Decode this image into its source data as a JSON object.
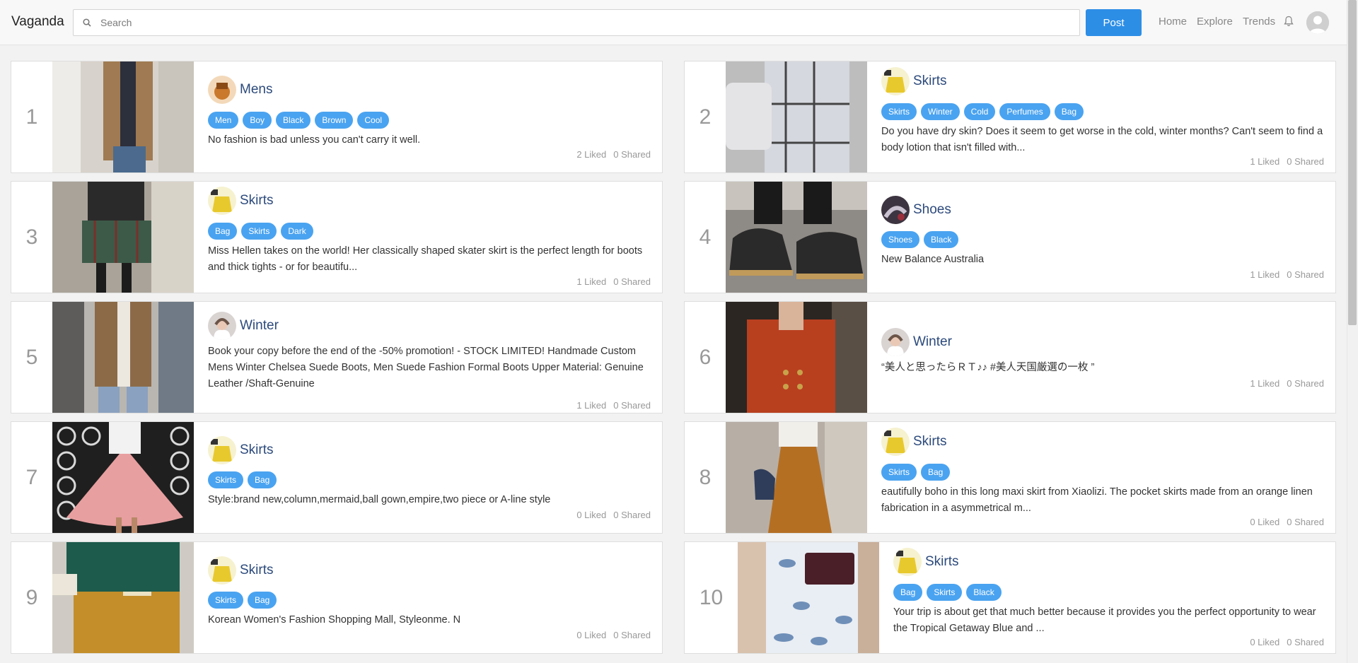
{
  "brand": "Vaganda",
  "search": {
    "placeholder": "Search"
  },
  "post_label": "Post",
  "nav": {
    "home": "Home",
    "explore": "Explore",
    "trends": "Trends"
  },
  "colors": {
    "accent": "#2d8ee6",
    "tag": "#4aa3f0",
    "title": "#2c4a7c"
  },
  "cards": [
    {
      "rank": "1",
      "title": "Mens",
      "tags": [
        "Men",
        "Boy",
        "Black",
        "Brown",
        "Cool"
      ],
      "desc": "No fashion is bad unless you can't carry it well.",
      "liked": "2 Liked",
      "shared": "0 Shared"
    },
    {
      "rank": "2",
      "title": "Skirts",
      "tags": [
        "Skirts",
        "Winter",
        "Cold",
        "Perfumes",
        "Bag"
      ],
      "desc": "Do you have dry skin? Does it seem to get worse in the cold, winter months? Can't seem to find a body lotion that isn't filled with...",
      "liked": "1 Liked",
      "shared": "0 Shared"
    },
    {
      "rank": "3",
      "title": "Skirts",
      "tags": [
        "Bag",
        "Skirts",
        "Dark"
      ],
      "desc": "Miss Hellen takes on the world! Her classically shaped skater skirt is the perfect length for boots and thick tights - or for beautifu...",
      "liked": "1 Liked",
      "shared": "0 Shared"
    },
    {
      "rank": "4",
      "title": "Shoes",
      "tags": [
        "Shoes",
        "Black"
      ],
      "desc": "New Balance Australia",
      "liked": "1 Liked",
      "shared": "0 Shared"
    },
    {
      "rank": "5",
      "title": "Winter",
      "tags": [],
      "desc": "Book your copy before the end of the -50% promotion! - STOCK LIMITED! Handmade Custom Mens Winter Chelsea Suede Boots, Men Suede Fashion Formal Boots Upper Material: Genuine Leather /Shaft-Genuine",
      "liked": "1 Liked",
      "shared": "0 Shared"
    },
    {
      "rank": "6",
      "title": "Winter",
      "tags": [],
      "desc": "“美人と思ったらＲＴ♪♪ #美人天国厳選の一枚 ”",
      "liked": "1 Liked",
      "shared": "0 Shared"
    },
    {
      "rank": "7",
      "title": "Skirts",
      "tags": [
        "Skirts",
        "Bag"
      ],
      "desc": "Style:brand new,column,mermaid,ball gown,empire,two piece or A-line style",
      "liked": "0 Liked",
      "shared": "0 Shared"
    },
    {
      "rank": "8",
      "title": "Skirts",
      "tags": [
        "Skirts",
        "Bag"
      ],
      "desc": "eautifully boho in this long maxi skirt from Xiaolizi. The pocket skirts made from an orange linen fabrication in a asymmetrical m...",
      "liked": "0 Liked",
      "shared": "0 Shared"
    },
    {
      "rank": "9",
      "title": "Skirts",
      "tags": [
        "Skirts",
        "Bag"
      ],
      "desc": "Korean Women's Fashion Shopping Mall, Styleonme. N",
      "liked": "0 Liked",
      "shared": "0 Shared"
    },
    {
      "rank": "10",
      "title": "Skirts",
      "tags": [
        "Bag",
        "Skirts",
        "Black"
      ],
      "desc": "Your trip is about get that much better because it provides you the perfect opportunity to wear the Tropical Getaway Blue and ...",
      "liked": "0 Liked",
      "shared": "0 Shared"
    }
  ]
}
